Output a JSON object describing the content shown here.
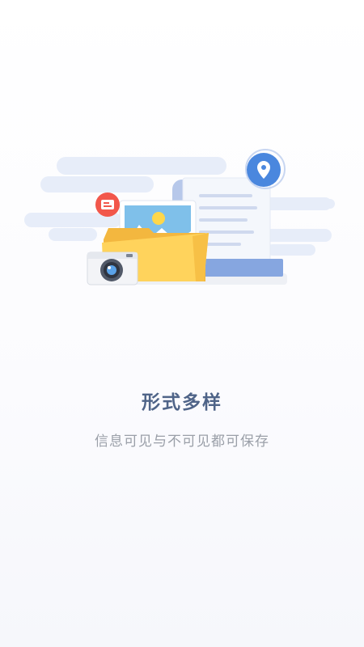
{
  "onboarding": {
    "title": "形式多样",
    "subtitle": "信息可见与不可见都可保存"
  },
  "illustration": {
    "icons": [
      "location-pin-icon",
      "photo-icon",
      "camera-icon",
      "folder-icon",
      "document-icon",
      "card-icon"
    ]
  },
  "colors": {
    "title": "#4f6488",
    "subtitle": "#9a9fa8",
    "folder": "#ffd15b",
    "accent_blue": "#4a90e2",
    "accent_red": "#f2574b",
    "cloud": "#e6ecf8"
  }
}
